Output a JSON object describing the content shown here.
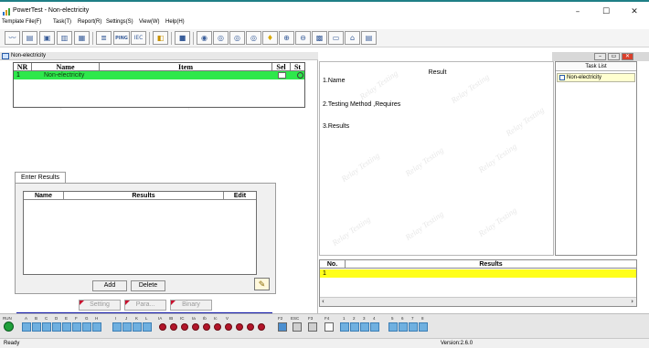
{
  "app": {
    "title": "PowerTest - Non-electricity"
  },
  "window_controls": [
    "–",
    "☐",
    "✕"
  ],
  "menu": [
    "Template File(F)",
    "Task(T)",
    "Report(R)",
    "Settings(S)",
    "View(W)",
    "Help(H)"
  ],
  "toolbar": {
    "labels": [
      "PING",
      "IEC"
    ]
  },
  "child_window": {
    "title": "Non-electricity"
  },
  "item_table": {
    "headers": [
      "NR",
      "Name",
      "Item",
      "Sel",
      "St"
    ],
    "rows": [
      {
        "nr": "1",
        "name": "Non-electricity",
        "item": "",
        "sel": "",
        "st": "○"
      }
    ]
  },
  "enter_results": {
    "tab": "Enter Results",
    "headers": [
      "Name",
      "Results",
      "Edit"
    ],
    "add_label": "Add",
    "delete_label": "Delete"
  },
  "setting_buttons": [
    "Setting",
    "Para...",
    "Binary"
  ],
  "result_panel": {
    "title": "Result",
    "lines": [
      "1.Name",
      "2.Testing Method ,Requires",
      "3.Results"
    ]
  },
  "task_list": {
    "title": "Task List",
    "items": [
      "Non-electricity"
    ]
  },
  "lower_table": {
    "headers": [
      "No.",
      "Results"
    ],
    "rows": [
      "1"
    ]
  },
  "bottom_bar": {
    "groups": [
      "RUN",
      "A",
      "B",
      "C",
      "D",
      "E",
      "F",
      "G",
      "H",
      "I",
      "J",
      "K",
      "L",
      "IA",
      "IB",
      "IC",
      "Ia",
      "Ib",
      "Ic",
      "V",
      "F2",
      "ESC",
      "F3",
      "F4",
      "1",
      "2",
      "3",
      "4",
      "5",
      "6",
      "7",
      "8"
    ]
  },
  "watermark": "Relay Testing",
  "status": {
    "left": "Ready",
    "version": "Version:2.6.0"
  }
}
